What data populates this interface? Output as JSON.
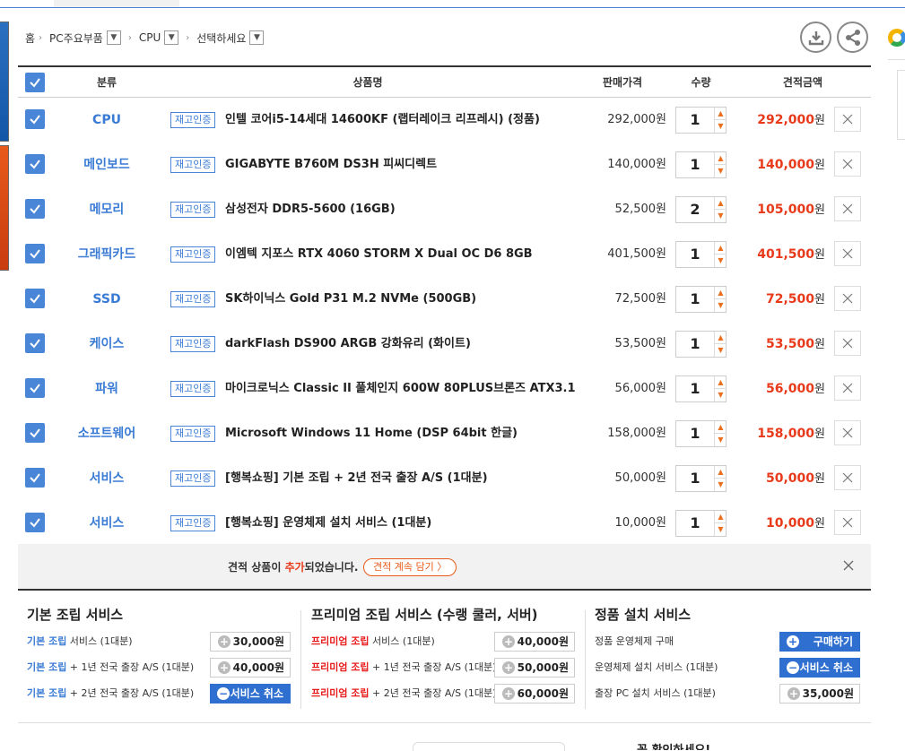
{
  "breadcrumb": {
    "home": "홈",
    "level1": "PC주요부품",
    "level2": "CPU",
    "level3": "선택하세요"
  },
  "icons": {
    "download": "download-icon",
    "share": "share-icon"
  },
  "table": {
    "headers": {
      "category": "분류",
      "product": "상품명",
      "price": "판매가격",
      "quantity": "수량",
      "total": "견적금액"
    },
    "stock_badge": "재고인증",
    "currency": "원",
    "rows": [
      {
        "category": "CPU",
        "product": "인텔 코어i5-14세대 14600KF (랩터레이크 리프레시) (정품)",
        "price": "292,000원",
        "qty": "1",
        "total": "292,000"
      },
      {
        "category": "메인보드",
        "product": "GIGABYTE B760M DS3H 피씨디렉트",
        "price": "140,000원",
        "qty": "1",
        "total": "140,000"
      },
      {
        "category": "메모리",
        "product": "삼성전자 DDR5-5600 (16GB)",
        "price": "52,500원",
        "qty": "2",
        "total": "105,000"
      },
      {
        "category": "그래픽카드",
        "product": "이엠텍 지포스 RTX 4060 STORM X Dual OC D6 8GB",
        "price": "401,500원",
        "qty": "1",
        "total": "401,500"
      },
      {
        "category": "SSD",
        "product": "SK하이닉스 Gold P31 M.2 NVMe (500GB)",
        "price": "72,500원",
        "qty": "1",
        "total": "72,500"
      },
      {
        "category": "케이스",
        "product": "darkFlash DS900 ARGB 강화유리 (화이트)",
        "price": "53,500원",
        "qty": "1",
        "total": "53,500"
      },
      {
        "category": "파워",
        "product": "마이크로닉스 Classic II 풀체인지 600W 80PLUS브론즈 ATX3.1",
        "price": "56,000원",
        "qty": "1",
        "total": "56,000"
      },
      {
        "category": "소프트웨어",
        "product": "Microsoft Windows 11 Home (DSP 64bit 한글)",
        "price": "158,000원",
        "qty": "1",
        "total": "158,000"
      },
      {
        "category": "서비스",
        "product": "[행복쇼핑] 기본 조립 + 2년 전국 출장 A/S (1대분)",
        "price": "50,000원",
        "qty": "1",
        "total": "50,000"
      },
      {
        "category": "서비스",
        "product": "[행복쇼핑] 운영체제 설치 서비스 (1대분)",
        "price": "10,000원",
        "qty": "1",
        "total": "10,000"
      }
    ]
  },
  "notice": {
    "msg_prefix": "견적 상품이 ",
    "msg_highlight": "추가",
    "msg_suffix": "되었습니다.",
    "more_label": "견적 계속 담기 〉"
  },
  "services": {
    "basic": {
      "title": "기본 조립 서비스",
      "items": [
        {
          "tag": "기본 조립",
          "desc": " 서비스 (1대분)",
          "price": "30,000원"
        },
        {
          "tag": "기본 조립",
          "desc": " + 1년 전국 출장 A/S (1대분)",
          "price": "40,000원"
        },
        {
          "tag": "기본 조립",
          "desc": " + 2년 전국 출장 A/S (1대분)",
          "action": "서비스 취소"
        }
      ]
    },
    "premium": {
      "title": "프리미엄 조립 서비스 (수랭 쿨러, 서버)",
      "items": [
        {
          "tag": "프리미엄 조립",
          "desc": " 서비스 (1대분)",
          "price": "40,000원"
        },
        {
          "tag": "프리미엄 조립",
          "desc": " + 1년 전국 출장 A/S (1대분)",
          "price": "50,000원"
        },
        {
          "tag": "프리미엄 조립",
          "desc": " + 2년 전국 출장 A/S (1대분)",
          "price": "60,000원"
        }
      ]
    },
    "install": {
      "title": "정품 설치 서비스",
      "items": [
        {
          "desc": "정품 운영체제 구매",
          "action": "구매하기"
        },
        {
          "desc": "운영체제 설치 서비스 (1대분)",
          "action": "서비스 취소"
        },
        {
          "desc": "출장 PC 설치 서비스 (1대분)",
          "price": "35,000원"
        }
      ]
    }
  },
  "bottom": {
    "text": "꼭 확인하세요!"
  },
  "colors": {
    "accent_blue": "#3a7bd5",
    "checkbox_blue": "#4a86d8",
    "total_red": "#e83a1a",
    "button_blue": "#2e6fd0"
  }
}
